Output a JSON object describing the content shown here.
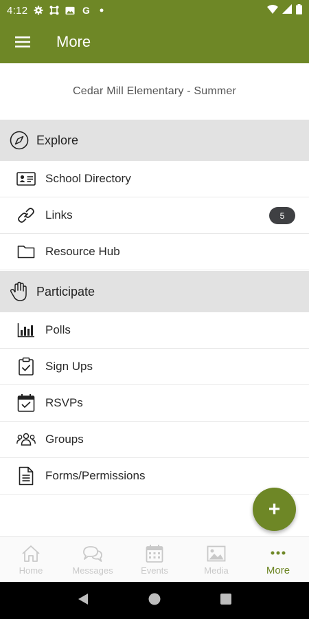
{
  "status_bar": {
    "time": "4:12",
    "icons": [
      "settings-icon",
      "hub-icon",
      "photo-icon",
      "google-icon",
      "dot-icon"
    ],
    "right_icons": [
      "wifi-icon",
      "signal-icon",
      "battery-icon"
    ]
  },
  "app_bar": {
    "title": "More",
    "menu_icon": "hamburger-icon"
  },
  "school": {
    "name": "Cedar Mill Elementary - Summer"
  },
  "sections": {
    "explore": {
      "label": "Explore",
      "icon": "compass-icon",
      "items": [
        {
          "label": "School Directory",
          "icon": "id-card-icon"
        },
        {
          "label": "Links",
          "icon": "link-icon",
          "badge": "5"
        },
        {
          "label": "Resource Hub",
          "icon": "folder-icon"
        }
      ]
    },
    "participate": {
      "label": "Participate",
      "icon": "hand-icon",
      "items": [
        {
          "label": "Polls",
          "icon": "bar-chart-icon"
        },
        {
          "label": "Sign Ups",
          "icon": "clipboard-check-icon"
        },
        {
          "label": "RSVPs",
          "icon": "calendar-check-icon"
        },
        {
          "label": "Groups",
          "icon": "people-icon"
        },
        {
          "label": "Forms/Permissions",
          "icon": "document-icon"
        }
      ]
    }
  },
  "fab": {
    "label": "+",
    "icon": "plus-icon"
  },
  "bottom_nav": [
    {
      "label": "Home",
      "icon": "home-icon",
      "active": false
    },
    {
      "label": "Messages",
      "icon": "chat-icon",
      "active": false
    },
    {
      "label": "Events",
      "icon": "calendar-icon",
      "active": false
    },
    {
      "label": "Media",
      "icon": "image-icon",
      "active": false
    },
    {
      "label": "More",
      "icon": "more-dots-icon",
      "active": true
    }
  ],
  "colors": {
    "brand": "#6e8726",
    "section_bg": "#e2e2e2",
    "badge_bg": "#3f4043",
    "nav_inactive": "#c9c9c9"
  }
}
